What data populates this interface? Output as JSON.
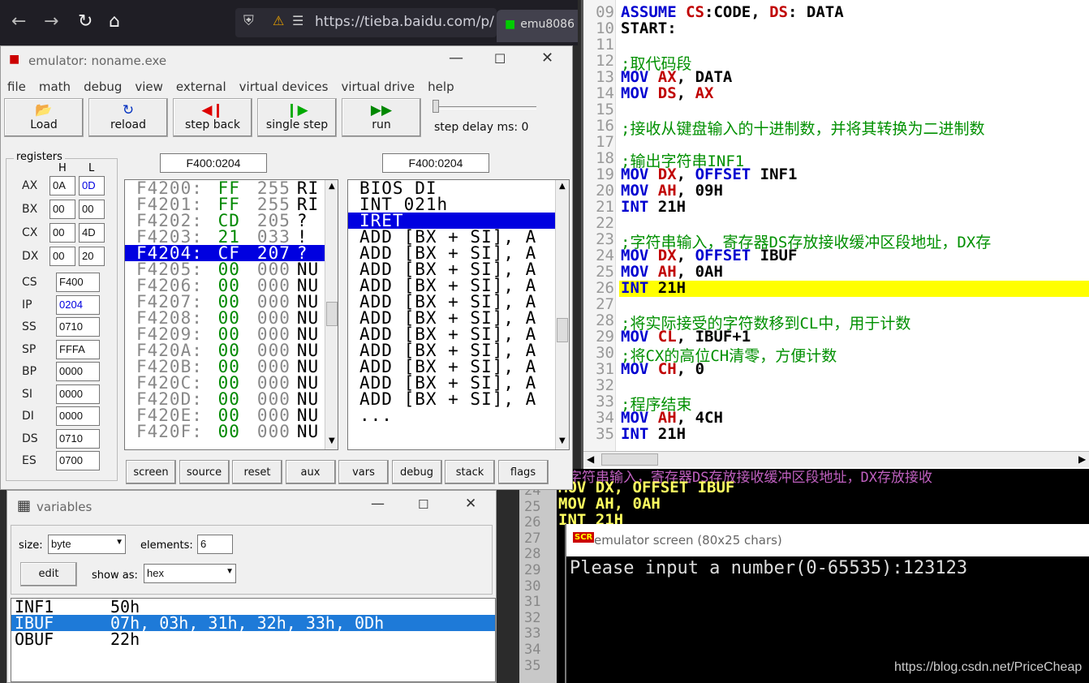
{
  "browser": {
    "url": "https://tieba.baidu.com/p/",
    "tab2": "emu8086"
  },
  "emulator": {
    "title": "emulator: noname.exe",
    "menu": [
      "file",
      "math",
      "debug",
      "view",
      "external",
      "virtual devices",
      "virtual drive",
      "help"
    ],
    "toolbar": {
      "load": "Load",
      "reload": "reload",
      "step_back": "step back",
      "single_step": "single step",
      "run": "run",
      "step_delay": "step delay ms: 0"
    },
    "registers_label": "registers",
    "h": "H",
    "l": "L",
    "regs8": [
      {
        "n": "AX",
        "h": "0A",
        "l": "0D"
      },
      {
        "n": "BX",
        "h": "00",
        "l": "00"
      },
      {
        "n": "CX",
        "h": "00",
        "l": "4D"
      },
      {
        "n": "DX",
        "h": "00",
        "l": "20"
      }
    ],
    "regs16": [
      {
        "n": "CS",
        "v": "F400"
      },
      {
        "n": "IP",
        "v": "0204"
      },
      {
        "n": "SS",
        "v": "0710"
      },
      {
        "n": "SP",
        "v": "FFFA"
      },
      {
        "n": "BP",
        "v": "0000"
      },
      {
        "n": "SI",
        "v": "0000"
      },
      {
        "n": "DI",
        "v": "0000"
      },
      {
        "n": "DS",
        "v": "0710"
      },
      {
        "n": "ES",
        "v": "0700"
      }
    ],
    "addr_left": "F400:0204",
    "addr_right": "F400:0204",
    "memory": [
      {
        "a": "F4200:",
        "h": "FF",
        "d": "255",
        "c": "RI"
      },
      {
        "a": "F4201:",
        "h": "FF",
        "d": "255",
        "c": "RI"
      },
      {
        "a": "F4202:",
        "h": "CD",
        "d": "205",
        "c": "?"
      },
      {
        "a": "F4203:",
        "h": "21",
        "d": "033",
        "c": "!"
      },
      {
        "a": "F4204:",
        "h": "CF",
        "d": "207",
        "c": "?"
      },
      {
        "a": "F4205:",
        "h": "00",
        "d": "000",
        "c": "NU"
      },
      {
        "a": "F4206:",
        "h": "00",
        "d": "000",
        "c": "NU"
      },
      {
        "a": "F4207:",
        "h": "00",
        "d": "000",
        "c": "NU"
      },
      {
        "a": "F4208:",
        "h": "00",
        "d": "000",
        "c": "NU"
      },
      {
        "a": "F4209:",
        "h": "00",
        "d": "000",
        "c": "NU"
      },
      {
        "a": "F420A:",
        "h": "00",
        "d": "000",
        "c": "NU"
      },
      {
        "a": "F420B:",
        "h": "00",
        "d": "000",
        "c": "NU"
      },
      {
        "a": "F420C:",
        "h": "00",
        "d": "000",
        "c": "NU"
      },
      {
        "a": "F420D:",
        "h": "00",
        "d": "000",
        "c": "NU"
      },
      {
        "a": "F420E:",
        "h": "00",
        "d": "000",
        "c": "NU"
      },
      {
        "a": "F420F:",
        "h": "00",
        "d": "000",
        "c": "NU"
      }
    ],
    "disasm": [
      "BIOS DI",
      "INT 021h",
      "IRET",
      "ADD [BX + SI], A",
      "ADD [BX + SI], A",
      "ADD [BX + SI], A",
      "ADD [BX + SI], A",
      "ADD [BX + SI], A",
      "ADD [BX + SI], A",
      "ADD [BX + SI], A",
      "ADD [BX + SI], A",
      "ADD [BX + SI], A",
      "ADD [BX + SI], A",
      "ADD [BX + SI], A",
      "..."
    ],
    "buttons": [
      "screen",
      "source",
      "reset",
      "aux",
      "vars",
      "debug",
      "stack",
      "flags"
    ]
  },
  "editor": {
    "lines": [
      {
        "n": "09",
        "t": "ASSUME CS:CODE, DS: DATA"
      },
      {
        "n": "10",
        "t": "START:"
      },
      {
        "n": "11",
        "t": ""
      },
      {
        "n": "12",
        "t": ";取代码段"
      },
      {
        "n": "13",
        "t": "MOV AX, DATA"
      },
      {
        "n": "14",
        "t": "MOV DS, AX"
      },
      {
        "n": "15",
        "t": ""
      },
      {
        "n": "16",
        "t": ";接收从键盘输入的十进制数，并将其转换为二进制数"
      },
      {
        "n": "17",
        "t": ""
      },
      {
        "n": "18",
        "t": ";输出字符串INF1"
      },
      {
        "n": "19",
        "t": "MOV DX, OFFSET INF1"
      },
      {
        "n": "20",
        "t": "MOV AH, 09H"
      },
      {
        "n": "21",
        "t": "INT 21H"
      },
      {
        "n": "22",
        "t": ""
      },
      {
        "n": "23",
        "t": ";字符串输入，寄存器DS存放接收缓冲区段地址，DX存"
      },
      {
        "n": "24",
        "t": "MOV DX, OFFSET IBUF"
      },
      {
        "n": "25",
        "t": "MOV AH, 0AH"
      },
      {
        "n": "26",
        "t": "INT 21H"
      },
      {
        "n": "27",
        "t": ""
      },
      {
        "n": "28",
        "t": ";将实际接受的字符数移到CL中，用于计数"
      },
      {
        "n": "29",
        "t": "MOV CL, IBUF+1"
      },
      {
        "n": "30",
        "t": ";将CX的高位CH清零，方便计数"
      },
      {
        "n": "31",
        "t": "MOV CH, 0"
      },
      {
        "n": "32",
        "t": ""
      },
      {
        "n": "33",
        "t": ";程序结束"
      },
      {
        "n": "34",
        "t": "MOV AH, 4CH"
      },
      {
        "n": "35",
        "t": "INT 21H"
      }
    ]
  },
  "background": {
    "l1": "字符串输入，寄存器DS存放接收缓冲区段地址，DX存放接收",
    "l2": "MOV DX, OFFSET IBUF",
    "l3": "MOV AH, 0AH",
    "l4": "INT 21H",
    "nums": [
      "24",
      "25",
      "26",
      "27",
      "28",
      "29",
      "30",
      "31",
      "32",
      "33",
      "34",
      "35"
    ]
  },
  "variables": {
    "title": "variables",
    "size_label": "size:",
    "size": "byte",
    "elements_label": "elements:",
    "elements": "6",
    "edit": "edit",
    "show_as_label": "show as:",
    "show_as": "hex",
    "rows": [
      {
        "n": "INF1",
        "v": "50h"
      },
      {
        "n": "IBUF",
        "v": "07h, 03h, 31h, 32h, 33h, 0Dh"
      },
      {
        "n": "OBUF",
        "v": "22h"
      }
    ]
  },
  "screen": {
    "title": "emulator screen (80x25 chars)",
    "output": "Please input a number(0-65535):123123"
  },
  "watermark": "https://blog.csdn.net/PriceCheap"
}
